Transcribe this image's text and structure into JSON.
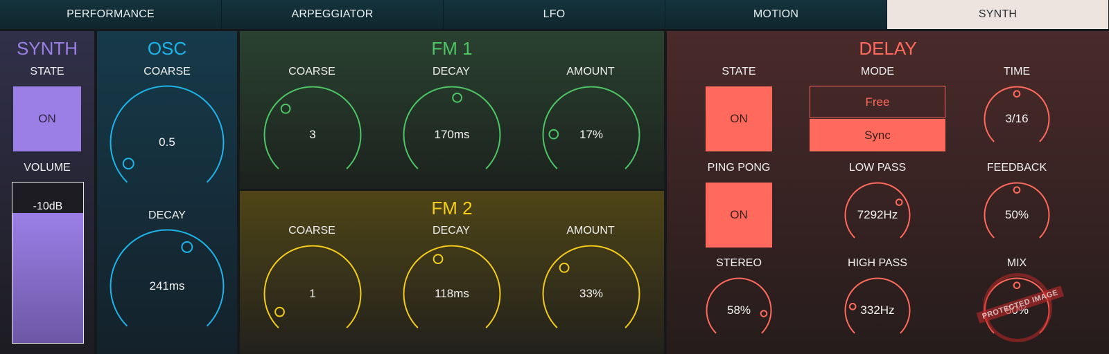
{
  "tabs": [
    "PERFORMANCE",
    "ARPEGGIATOR",
    "LFO",
    "MOTION",
    "SYNTH"
  ],
  "active_tab": "SYNTH",
  "synth": {
    "title": "SYNTH",
    "state_label": "STATE",
    "state_value": "ON",
    "volume_label": "VOLUME",
    "volume_value": "-10dB",
    "volume_level": 0.81
  },
  "osc": {
    "title": "OSC",
    "coarse_label": "COARSE",
    "coarse_value": "0.5",
    "coarse_pos": 0.06,
    "decay_label": "DECAY",
    "decay_value": "241ms",
    "decay_pos": 0.6
  },
  "fm1": {
    "title": "FM 1",
    "coarse_label": "COARSE",
    "coarse_value": "3",
    "coarse_pos": 0.33,
    "decay_label": "DECAY",
    "decay_value": "170ms",
    "decay_pos": 0.53,
    "amount_label": "AMOUNT",
    "amount_value": "17%",
    "amount_pos": 0.17
  },
  "fm2": {
    "title": "FM 2",
    "coarse_label": "COARSE",
    "coarse_value": "1",
    "coarse_pos": 0.06,
    "decay_label": "DECAY",
    "decay_value": "118ms",
    "decay_pos": 0.42,
    "amount_label": "AMOUNT",
    "amount_value": "33%",
    "amount_pos": 0.33
  },
  "delay": {
    "title": "DELAY",
    "state_label": "STATE",
    "state_value": "ON",
    "mode_label": "MODE",
    "mode_options": [
      "Free",
      "Sync"
    ],
    "mode_selected": "Sync",
    "time_label": "TIME",
    "time_value": "3/16",
    "time_pos": 0.5,
    "pingpong_label": "PING PONG",
    "pingpong_value": "ON",
    "lowpass_label": "LOW PASS",
    "lowpass_value": "7292Hz",
    "lowpass_pos": 0.72,
    "feedback_label": "FEEDBACK",
    "feedback_value": "50%",
    "feedback_pos": 0.5,
    "stereo_label": "STEREO",
    "stereo_value": "58%",
    "stereo_pos": 0.86,
    "highpass_label": "HIGH PASS",
    "highpass_value": "332Hz",
    "highpass_pos": 0.2,
    "mix_label": "MIX",
    "mix_value": "50%",
    "mix_pos": 0.5
  },
  "watermark": "PROTECTED IMAGE",
  "colors": {
    "synth": "#9b7fe6",
    "osc": "#1eb4ea",
    "fm1": "#4cc764",
    "fm2": "#f5cc1a",
    "delay": "#ff6a5c"
  }
}
